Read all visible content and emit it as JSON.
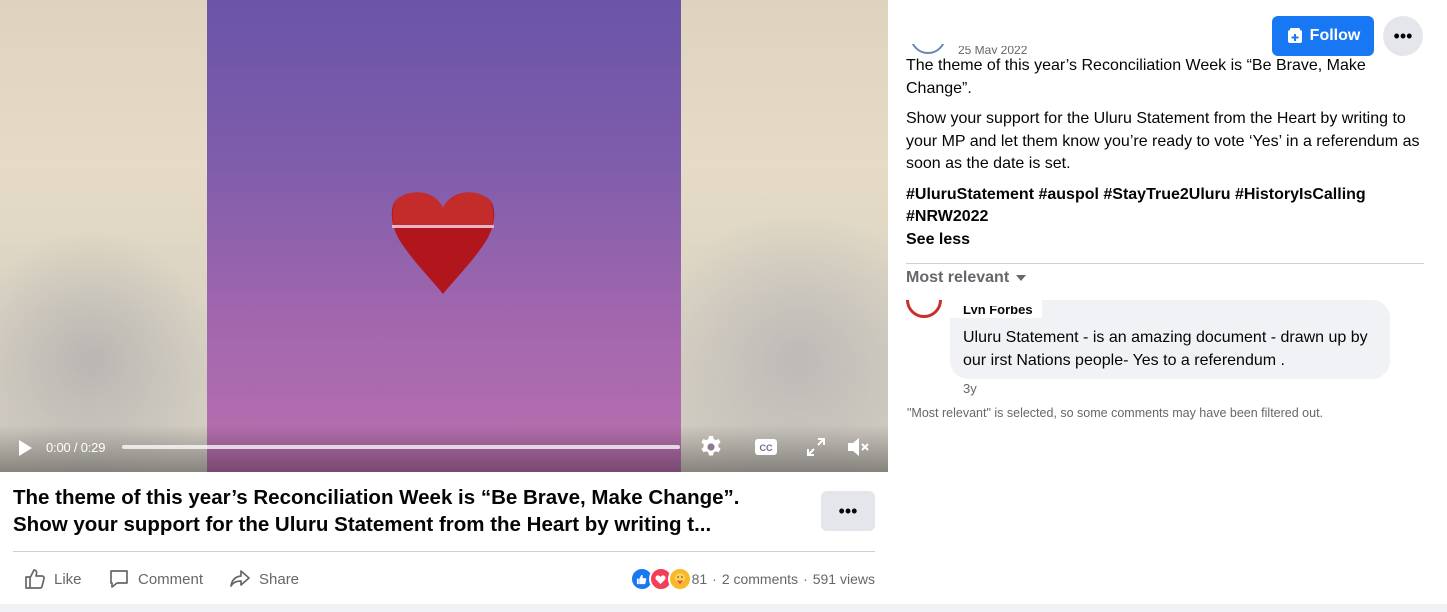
{
  "video": {
    "time": "0:00 / 0:29",
    "progress": 0
  },
  "caption": {
    "line1": "The theme of this year’s Reconciliation Week is “Be Brave, Make Change”.",
    "line2": "Show your support for the Uluru Statement from the Heart by writing t..."
  },
  "actions": {
    "like": "Like",
    "comment": "Comment",
    "share": "Share"
  },
  "stats": {
    "reactions": "81",
    "comments": "2 comments",
    "views": "591 views"
  },
  "header": {
    "follow": "Follow",
    "date": "25 May 2022"
  },
  "post": {
    "para1": "The theme of this year’s Reconciliation Week is “Be Brave, Make Change”.",
    "para2": "Show your support for the Uluru Statement from the Heart by writing to your MP and let them know you’re ready to vote ‘Yes’ in a referendum as soon as the date is set.",
    "tags1": "#UluruStatement #auspol #StayTrue2Uluru #HistoryIsCalling",
    "tags2": "#NRW2022",
    "see_less": "See less"
  },
  "comments": {
    "sort": "Most relevant",
    "items": [
      {
        "author": "Lyn Forbes",
        "text": "Uluru Statement - is an amazing document - drawn up by our irst Nations people- Yes to a referendum .",
        "time": "3y"
      }
    ],
    "filter_note": "\"Most relevant\" is selected, so some comments may have been filtered out."
  }
}
